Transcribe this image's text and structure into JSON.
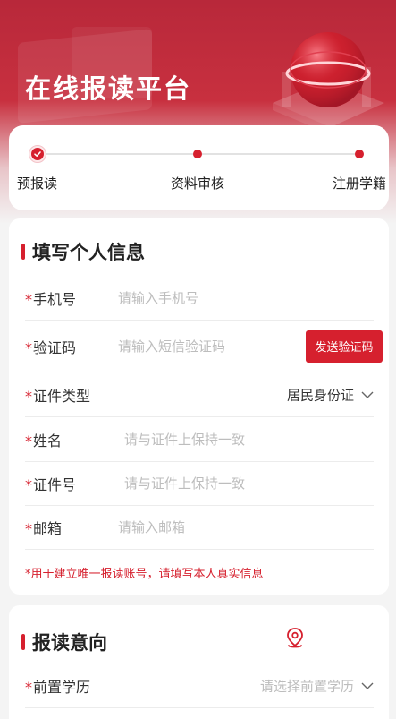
{
  "header": {
    "title": "在线报读平台"
  },
  "steps": [
    {
      "label": "预报读",
      "state": "done"
    },
    {
      "label": "资料审核",
      "state": "pending"
    },
    {
      "label": "注册学籍",
      "state": "pending"
    }
  ],
  "personal": {
    "title": "填写个人信息",
    "required_mark": "*",
    "phone": {
      "label": "手机号",
      "placeholder": "请输入手机号"
    },
    "code": {
      "label": "验证码",
      "placeholder": "请输入短信验证码",
      "button": "发送验证码"
    },
    "id_type": {
      "label": "证件类型",
      "value": "居民身份证"
    },
    "name": {
      "label": "姓名",
      "placeholder": "请与证件上保持一致"
    },
    "id_number": {
      "label": "证件号",
      "placeholder": "请与证件上保持一致"
    },
    "email": {
      "label": "邮箱",
      "placeholder": "请输入邮箱"
    },
    "note": "*用于建立唯一报读账号，请填写本人真实信息"
  },
  "intent": {
    "title": "报读意向",
    "education": {
      "label": "前置学历",
      "placeholder": "请选择前置学历"
    }
  },
  "colors": {
    "accent": "#d6202e",
    "header_red": "#b8283a"
  }
}
